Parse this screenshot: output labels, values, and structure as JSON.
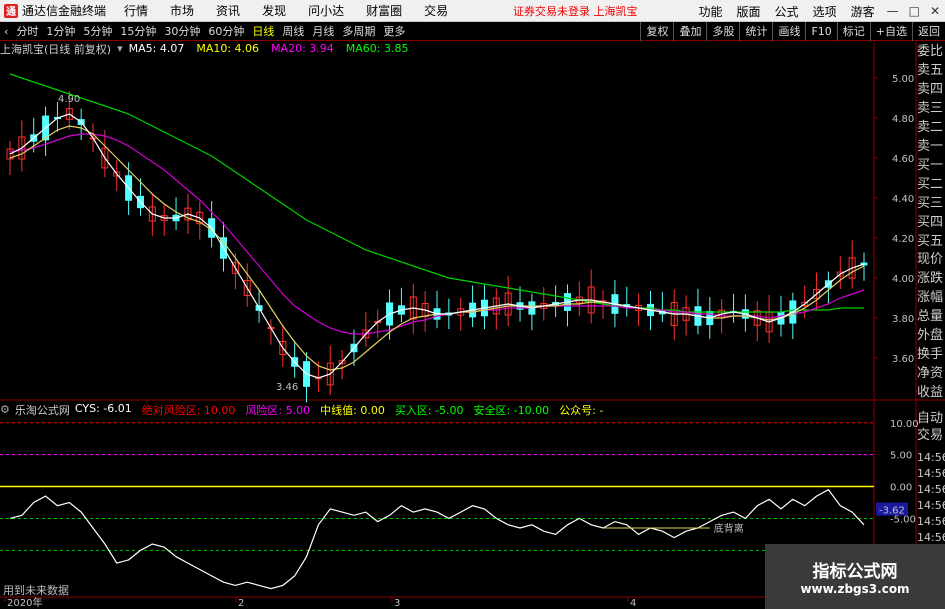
{
  "app": {
    "title": "通达信金融终端",
    "notice": "证券交易未登录",
    "stock_link": "上海凯宝"
  },
  "top_menu": [
    "行情",
    "市场",
    "资讯",
    "发现",
    "问小达",
    "财富圈",
    "交易"
  ],
  "top_right": [
    "功能",
    "版面",
    "公式",
    "选项",
    "游客"
  ],
  "toolbar": {
    "periods": [
      "分时",
      "1分钟",
      "5分钟",
      "15分钟",
      "30分钟",
      "60分钟",
      "日线",
      "周线",
      "月线",
      "多周期",
      "更多"
    ],
    "active": "日线",
    "right_buttons": [
      "复权",
      "叠加",
      "多股",
      "统计",
      "画线",
      "F10",
      "标记",
      "+自选",
      "返回"
    ]
  },
  "main_chart": {
    "stock_title": "上海凯宝(日线 前复权)",
    "ma_labels": [
      {
        "text": "MA5: 4.07",
        "color": "#ffffff"
      },
      {
        "text": "MA10: 4.06",
        "color": "#ffff00"
      },
      {
        "text": "MA20: 3.94",
        "color": "#ff00ff"
      },
      {
        "text": "MA60: 3.85",
        "color": "#00ff00"
      }
    ],
    "high_label": "4.90",
    "low_label": "3.46",
    "y_ticks": [
      "5.00",
      "4.80",
      "4.60",
      "4.40",
      "4.20",
      "4.00",
      "3.80",
      "3.60"
    ],
    "current_price_label": "4.00"
  },
  "right_panel": [
    "委比",
    "卖五",
    "卖四",
    "卖三",
    "卖二",
    "卖一",
    "买一",
    "买二",
    "买三",
    "买四",
    "买五",
    "现价",
    "涨跌",
    "涨幅",
    "总量",
    "外盘",
    "换手",
    "净资",
    "收益"
  ],
  "indicator": {
    "name": "乐淘公式网",
    "values": [
      {
        "text": "CYS: -6.01",
        "color": "#ffffff"
      },
      {
        "text": "绝对风险区: 10.00",
        "color": "#ff0000"
      },
      {
        "text": "风险区: 5.00",
        "color": "#ff00ff"
      },
      {
        "text": "中线值: 0.00",
        "color": "#ffff00"
      },
      {
        "text": "买入区: -5.00",
        "color": "#00ff00"
      },
      {
        "text": "安全区: -10.00",
        "color": "#00ff00"
      },
      {
        "text": "公众号: -",
        "color": "#ffff00"
      }
    ],
    "y_ticks": [
      "10.00",
      "5.00",
      "0.00",
      "-5.00"
    ],
    "current_label": "-3.62",
    "divergence_label": "底背离",
    "right_labels": [
      "自动",
      "交易"
    ],
    "time_labels": [
      "14:56",
      "14:56",
      "14:56",
      "14:56",
      "14:56",
      "14:56",
      "14:56"
    ]
  },
  "x_axis": [
    "2020年",
    "2",
    "3",
    "4"
  ],
  "future_data": "用到未来数据",
  "watermark": {
    "line1": "指标公式网",
    "line2": "www.zbgs3.com"
  },
  "chart_data": {
    "type": "line",
    "ma5": [
      4.62,
      4.65,
      4.7,
      4.75,
      4.8,
      4.82,
      4.78,
      4.7,
      4.6,
      4.52,
      4.45,
      4.38,
      4.32,
      4.3,
      4.3,
      4.32,
      4.3,
      4.25,
      4.15,
      4.05,
      3.95,
      3.85,
      3.75,
      3.65,
      3.58,
      3.52,
      3.5,
      3.52,
      3.58,
      3.65,
      3.72,
      3.78,
      3.82,
      3.84,
      3.85,
      3.84,
      3.82,
      3.82,
      3.83,
      3.84,
      3.85,
      3.86,
      3.87,
      3.86,
      3.85,
      3.86,
      3.87,
      3.88,
      3.89,
      3.89,
      3.88,
      3.87,
      3.86,
      3.85,
      3.84,
      3.83,
      3.82,
      3.82,
      3.81,
      3.8,
      3.82,
      3.83,
      3.82,
      3.8,
      3.78,
      3.8,
      3.83,
      3.87,
      3.92,
      3.97,
      4.02,
      4.05,
      4.07
    ],
    "ma10": [
      4.6,
      4.62,
      4.66,
      4.7,
      4.74,
      4.76,
      4.75,
      4.72,
      4.66,
      4.6,
      4.54,
      4.48,
      4.42,
      4.37,
      4.33,
      4.3,
      4.28,
      4.24,
      4.18,
      4.1,
      4.02,
      3.94,
      3.85,
      3.76,
      3.68,
      3.61,
      3.56,
      3.54,
      3.55,
      3.58,
      3.63,
      3.68,
      3.73,
      3.77,
      3.8,
      3.81,
      3.82,
      3.82,
      3.83,
      3.83,
      3.84,
      3.85,
      3.86,
      3.86,
      3.86,
      3.86,
      3.86,
      3.87,
      3.87,
      3.88,
      3.88,
      3.87,
      3.86,
      3.85,
      3.84,
      3.83,
      3.82,
      3.82,
      3.81,
      3.8,
      3.8,
      3.81,
      3.81,
      3.8,
      3.79,
      3.8,
      3.82,
      3.85,
      3.89,
      3.94,
      3.99,
      4.03,
      4.06
    ],
    "ma20": [
      4.63,
      4.64,
      4.65,
      4.67,
      4.69,
      4.71,
      4.72,
      4.72,
      4.71,
      4.69,
      4.66,
      4.62,
      4.58,
      4.54,
      4.49,
      4.44,
      4.39,
      4.33,
      4.27,
      4.2,
      4.13,
      4.06,
      3.99,
      3.92,
      3.86,
      3.82,
      3.78,
      3.75,
      3.73,
      3.72,
      3.72,
      3.73,
      3.74,
      3.76,
      3.78,
      3.79,
      3.81,
      3.82,
      3.83,
      3.83,
      3.84,
      3.84,
      3.85,
      3.85,
      3.85,
      3.86,
      3.86,
      3.86,
      3.86,
      3.86,
      3.86,
      3.86,
      3.85,
      3.85,
      3.84,
      3.84,
      3.83,
      3.83,
      3.82,
      3.82,
      3.81,
      3.81,
      3.81,
      3.81,
      3.8,
      3.81,
      3.82,
      3.83,
      3.85,
      3.87,
      3.9,
      3.92,
      3.94
    ],
    "ma60": [
      5.02,
      5.0,
      4.98,
      4.96,
      4.94,
      4.92,
      4.9,
      4.88,
      4.86,
      4.84,
      4.82,
      4.79,
      4.76,
      4.73,
      4.7,
      4.67,
      4.64,
      4.61,
      4.57,
      4.53,
      4.49,
      4.45,
      4.41,
      4.37,
      4.33,
      4.29,
      4.26,
      4.23,
      4.2,
      4.17,
      4.14,
      4.12,
      4.1,
      4.08,
      4.06,
      4.04,
      4.02,
      4.0,
      3.99,
      3.98,
      3.97,
      3.96,
      3.95,
      3.94,
      3.93,
      3.92,
      3.91,
      3.9,
      3.89,
      3.88,
      3.87,
      3.86,
      3.86,
      3.85,
      3.85,
      3.84,
      3.84,
      3.83,
      3.83,
      3.83,
      3.83,
      3.83,
      3.83,
      3.83,
      3.83,
      3.83,
      3.84,
      3.84,
      3.84,
      3.84,
      3.85,
      3.85,
      3.85
    ],
    "cys": [
      -5.0,
      -4.5,
      -2.5,
      -1.5,
      -3.0,
      -2.5,
      -4.0,
      -6.5,
      -9.0,
      -12.0,
      -11.5,
      -10.0,
      -9.0,
      -9.5,
      -11.0,
      -12.0,
      -13.0,
      -14.0,
      -15.0,
      -15.5,
      -15.0,
      -15.5,
      -16.0,
      -15.5,
      -14.0,
      -11.0,
      -6.0,
      -3.5,
      -4.0,
      -4.5,
      -4.0,
      -5.5,
      -4.5,
      -3.0,
      -4.0,
      -3.5,
      -4.0,
      -5.0,
      -4.0,
      -3.0,
      -3.5,
      -5.0,
      -6.0,
      -6.5,
      -6.0,
      -7.0,
      -7.5,
      -6.0,
      -5.0,
      -6.0,
      -6.5,
      -5.5,
      -6.0,
      -7.5,
      -6.5,
      -7.0,
      -8.0,
      -7.0,
      -6.5,
      -5.5,
      -4.5,
      -4.0,
      -5.0,
      -3.0,
      -2.0,
      -3.5,
      -2.0,
      -3.0,
      -1.5,
      -0.5,
      -3.0,
      -4.0,
      -6.0
    ],
    "ylim": [
      3.4,
      5.1
    ],
    "indicator_ylim": [
      -17,
      12
    ]
  }
}
